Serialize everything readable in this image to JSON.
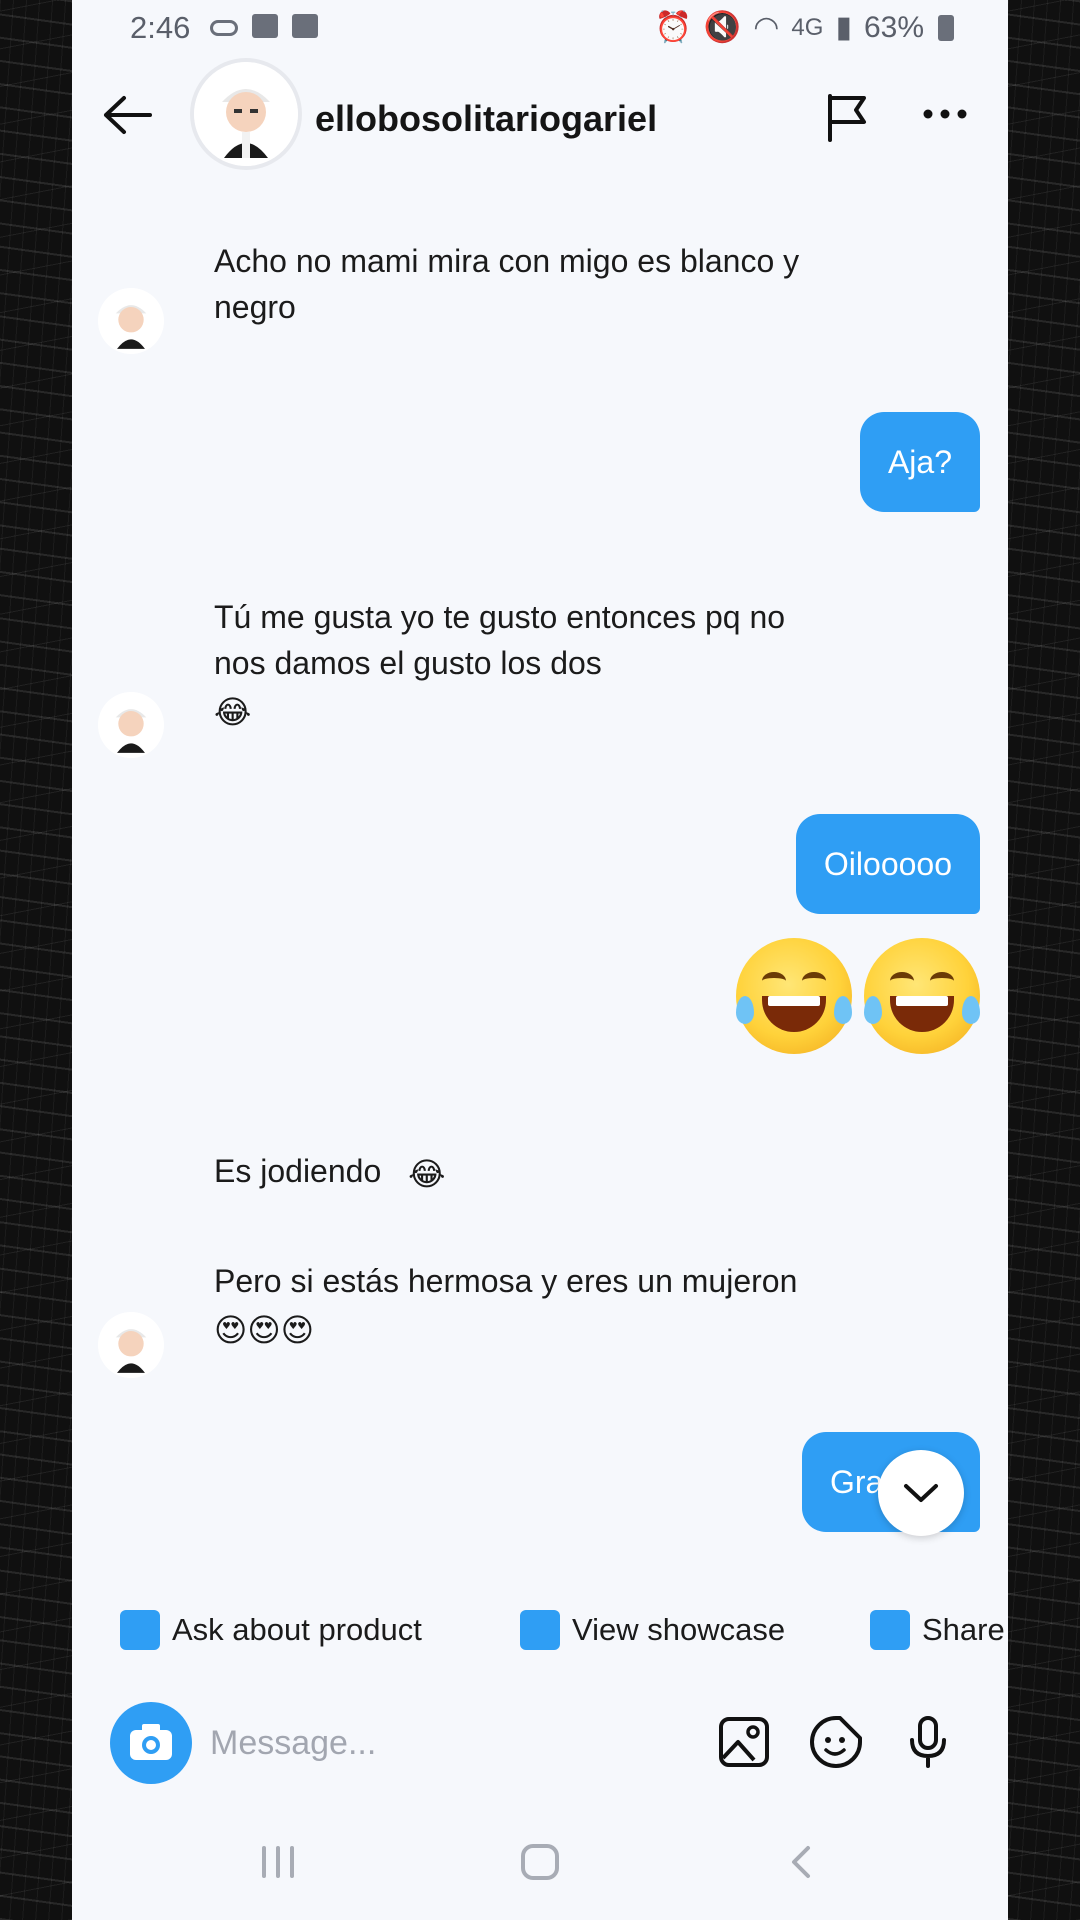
{
  "status_bar": {
    "time": "2:46",
    "network": "4G",
    "battery": "63%"
  },
  "header": {
    "username": "ellobosolitariogariel"
  },
  "messages": [
    {
      "direction": "in",
      "text": "Acho no mami mira con migo es blanco y negro"
    },
    {
      "direction": "out",
      "text": "Aja?"
    },
    {
      "direction": "in",
      "text": "Tú me gusta yo te gusto entonces pq no nos damos el gusto los dos",
      "emoji": "😂"
    },
    {
      "direction": "out",
      "text": "Oilooooo"
    },
    {
      "direction": "out",
      "emoji": "😂😂"
    },
    {
      "direction": "in",
      "text": "Es jodiendo",
      "emoji": "😂"
    },
    {
      "direction": "in",
      "text": "Pero si estás hermosa y eres un mujeron",
      "emoji": "😍😍😍"
    },
    {
      "direction": "out",
      "text": "Gra"
    }
  ],
  "quick_actions": [
    {
      "label": "Ask about product",
      "icon": "shopping-bag-icon"
    },
    {
      "label": "View showcase",
      "icon": "store-icon"
    },
    {
      "label": "Share",
      "icon": "share-icon"
    }
  ],
  "input": {
    "placeholder": "Message..."
  },
  "colors": {
    "accent": "#2f9ef4",
    "background": "#f6f8fc",
    "text": "#1b1b1b"
  }
}
